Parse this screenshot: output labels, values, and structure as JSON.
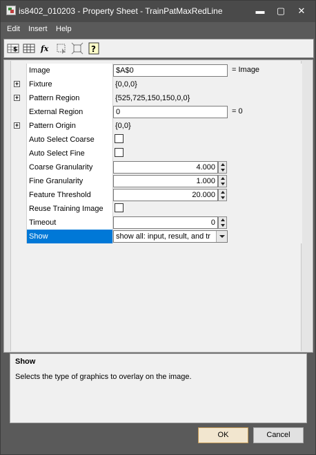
{
  "window": {
    "title": "is8402_010203 - Property Sheet - TrainPatMaxRedLine",
    "app_icon": "spreadsheet-icon",
    "controls": {
      "minimize": "▬",
      "maximize": "▢",
      "close": "✕"
    }
  },
  "menu": [
    "Edit",
    "Insert",
    "Help"
  ],
  "toolbar": [
    {
      "name": "cell-reference-icon",
      "glyph": "$"
    },
    {
      "name": "table-grid-icon",
      "glyph": "▦"
    },
    {
      "name": "function-icon",
      "glyph": "fx"
    },
    {
      "name": "select-region-icon",
      "glyph": "⬚"
    },
    {
      "name": "fit-region-icon",
      "glyph": "⌗"
    },
    {
      "name": "help-icon",
      "glyph": "?"
    }
  ],
  "properties": [
    {
      "name": "Image",
      "value": "$A$0",
      "kind": "input",
      "suffix": "= Image"
    },
    {
      "name": "Fixture",
      "value": "{0,0,0}",
      "kind": "text",
      "expandable": true
    },
    {
      "name": "Pattern Region",
      "value": "{525,725,150,150,0,0}",
      "kind": "text",
      "expandable": true
    },
    {
      "name": "External Region",
      "value": "0",
      "kind": "input",
      "suffix": "= 0"
    },
    {
      "name": "Pattern Origin",
      "value": "{0,0}",
      "kind": "text",
      "expandable": true
    },
    {
      "name": "Auto Select Coarse",
      "value": "",
      "kind": "checkbox",
      "checked": false
    },
    {
      "name": "Auto Select Fine",
      "value": "",
      "kind": "checkbox",
      "checked": false
    },
    {
      "name": "Coarse Granularity",
      "value": "4.000",
      "kind": "spin"
    },
    {
      "name": "Fine Granularity",
      "value": "1.000",
      "kind": "spin"
    },
    {
      "name": "Feature Threshold",
      "value": "20.000",
      "kind": "spin"
    },
    {
      "name": "Reuse Training Image",
      "value": "",
      "kind": "checkbox",
      "checked": false
    },
    {
      "name": "Timeout",
      "value": "0",
      "kind": "spin"
    },
    {
      "name": "Show",
      "value": "show all: input, result, and tr",
      "kind": "combo",
      "selected": true
    }
  ],
  "description": {
    "title": "Show",
    "text": "Selects the type of graphics to overlay on the image."
  },
  "buttons": {
    "ok": "OK",
    "cancel": "Cancel"
  }
}
